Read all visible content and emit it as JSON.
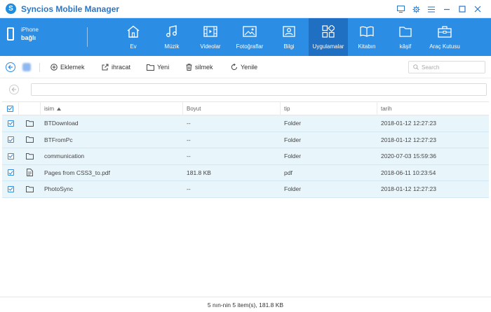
{
  "app": {
    "title": "Syncios Mobile Manager",
    "accent": "#2c8de5"
  },
  "window_controls": [
    "feedback-icon",
    "settings-icon",
    "menu-icon",
    "minimize-icon",
    "maximize-icon",
    "close-icon"
  ],
  "device": {
    "name": "iPhone",
    "status": "bağlı"
  },
  "nav": [
    {
      "label": "Ev",
      "icon": "home-icon"
    },
    {
      "label": "Müzik",
      "icon": "music-icon"
    },
    {
      "label": "Videolar",
      "icon": "video-icon"
    },
    {
      "label": "Fotoğraflar",
      "icon": "photo-icon"
    },
    {
      "label": "Bilgi",
      "icon": "contact-card-icon"
    },
    {
      "label": "Uygulamalar",
      "icon": "apps-icon",
      "active": true
    },
    {
      "label": "Kitabın",
      "icon": "book-icon"
    },
    {
      "label": "kâşif",
      "icon": "folder-icon"
    },
    {
      "label": "Araç Kutusu",
      "icon": "toolbox-icon"
    }
  ],
  "toolbar": {
    "add_label": "Eklemek",
    "export_label": "ihracat",
    "new_label": "Yeni",
    "delete_label": "silmek",
    "refresh_label": "Yenile",
    "search_placeholder": "Search"
  },
  "table": {
    "headers": {
      "name": "isim",
      "size": "Boyut",
      "type": "tip",
      "date": "tarih"
    },
    "rows": [
      {
        "icon": "folder-icon",
        "name": "BTDownload",
        "size": "--",
        "type": "Folder",
        "date": "2018-01-12 12:27:23"
      },
      {
        "icon": "folder-icon",
        "name": "BTFromPc",
        "size": "--",
        "type": "Folder",
        "date": "2018-01-12 12:27:23"
      },
      {
        "icon": "folder-icon",
        "name": "communication",
        "size": "--",
        "type": "Folder",
        "date": "2020-07-03 15:59:36"
      },
      {
        "icon": "file-icon",
        "name": "Pages from CSS3_to.pdf",
        "size": "181.8 KB",
        "type": "pdf",
        "date": "2018-06-11 10:23:54"
      },
      {
        "icon": "folder-icon",
        "name": "PhotoSync",
        "size": "--",
        "type": "Folder",
        "date": "2018-01-12 12:27:23"
      }
    ]
  },
  "status": {
    "text": "5 nın-nin 5 item(s), 181.8 KB"
  }
}
